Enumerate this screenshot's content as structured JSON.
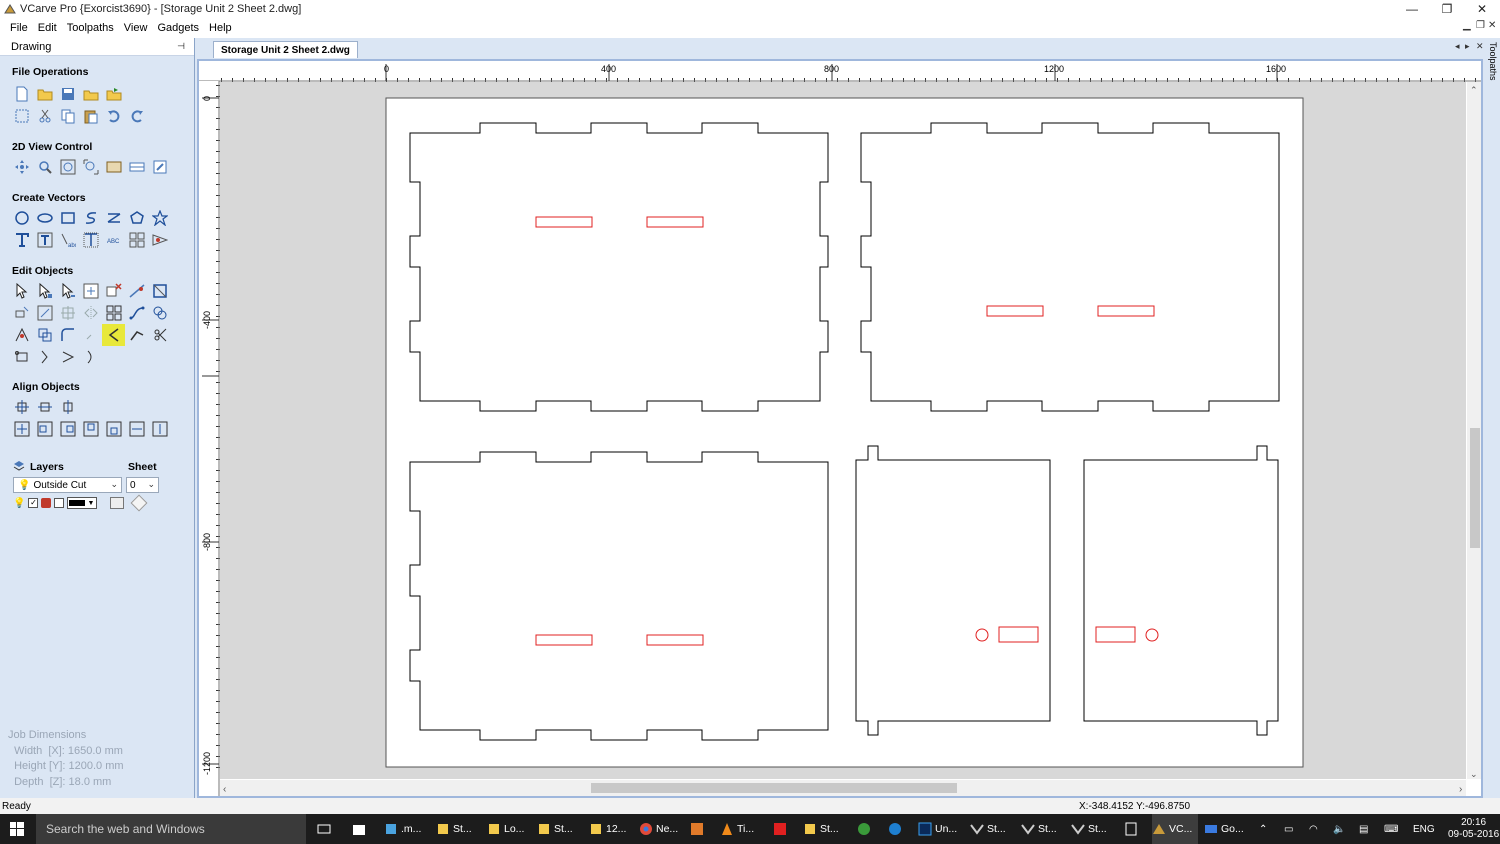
{
  "window": {
    "title": "VCarve Pro {Exorcist3690} - [Storage Unit 2 Sheet 2.dwg]",
    "minimize": "—",
    "restore": "❐",
    "close": "✕"
  },
  "menubar": {
    "items": [
      "File",
      "Edit",
      "Toolpaths",
      "View",
      "Gadgets",
      "Help"
    ],
    "mdi_min": "▁",
    "mdi_restore": "❐",
    "mdi_close": "✕"
  },
  "sidebar": {
    "header": "Drawing",
    "pin": "⊣",
    "sections": {
      "file_operations": "File Operations",
      "view_control": "2D View Control",
      "create_vectors": "Create Vectors",
      "edit_objects": "Edit Objects",
      "align_objects": "Align Objects"
    },
    "layers_label": "Layers",
    "sheet_label": "Sheet",
    "layer_value": "Outside Cut",
    "sheet_value": "0",
    "job_dimensions": {
      "title": "Job Dimensions",
      "width": "  Width  [X]: 1650.0 mm",
      "height": "  Height [Y]: 1200.0 mm",
      "depth": "  Depth  [Z]: 18.0 mm"
    }
  },
  "document": {
    "tab": "Storage Unit 2 Sheet 2.dwg",
    "right_panel": "Toolpaths",
    "ruler_h": [
      "0",
      "400",
      "800",
      "1200",
      "1600"
    ],
    "ruler_v": [
      "0",
      "-400",
      "-800",
      "-1200"
    ]
  },
  "status": {
    "left": "Ready",
    "coords": "X:-348.4152 Y:-496.8750"
  },
  "taskbar": {
    "search": "Search the web and Windows",
    "apps": [
      ".m...",
      "St...",
      "Lo...",
      "St...",
      "12...",
      "Ne...",
      "",
      "Ti...",
      "",
      "St...",
      "",
      "",
      "Un...",
      "St...",
      "St...",
      "St...",
      "",
      "VC...",
      "Go..."
    ],
    "lang": "ENG",
    "time": "20:16",
    "date": "09-05-2016"
  },
  "colors": {
    "sidebar_bg": "#dbe6f4",
    "vector": "#000000",
    "cut": "#e02020",
    "selected_tool": "#e8e83a",
    "taskbar": "#1c1c1c"
  }
}
